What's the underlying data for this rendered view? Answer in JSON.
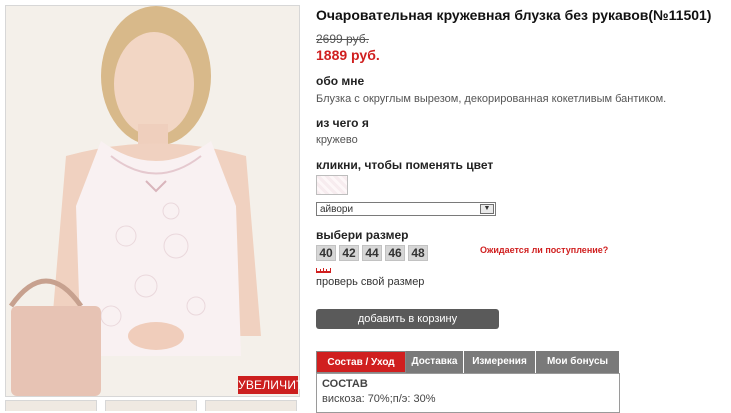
{
  "product": {
    "title": "Очаровательная кружевная блузка без рукавов(№11501)",
    "old_price": "2699 руб.",
    "new_price": "1889 руб."
  },
  "about": {
    "label": "обо мне",
    "text": "Блузка с округлым вырезом, декорированная кокетливым бантиком."
  },
  "material": {
    "label": "из чего я",
    "text": "кружево"
  },
  "color": {
    "label": "кликни, чтобы поменять цвет",
    "selected": "айвори"
  },
  "size": {
    "label": "выбери размер",
    "options": [
      "40",
      "42",
      "44",
      "46",
      "48"
    ],
    "await_link": "Ожидается ли поступление?",
    "check_link": "проверь свой размер"
  },
  "cart": {
    "button": "добавить в корзину"
  },
  "zoom": {
    "button": "УВЕЛИЧИТЬ"
  },
  "tabs": [
    "Состав / Уход",
    "Доставка",
    "Измерения",
    "Мои бонусы"
  ],
  "tab_panel": {
    "heading": "СОСТАВ",
    "text": "вискоза: 70%;п/э: 30%"
  },
  "colors": {
    "accent": "#d01f1f",
    "button": "#5a5a5a",
    "tab": "#7a7a7a"
  }
}
